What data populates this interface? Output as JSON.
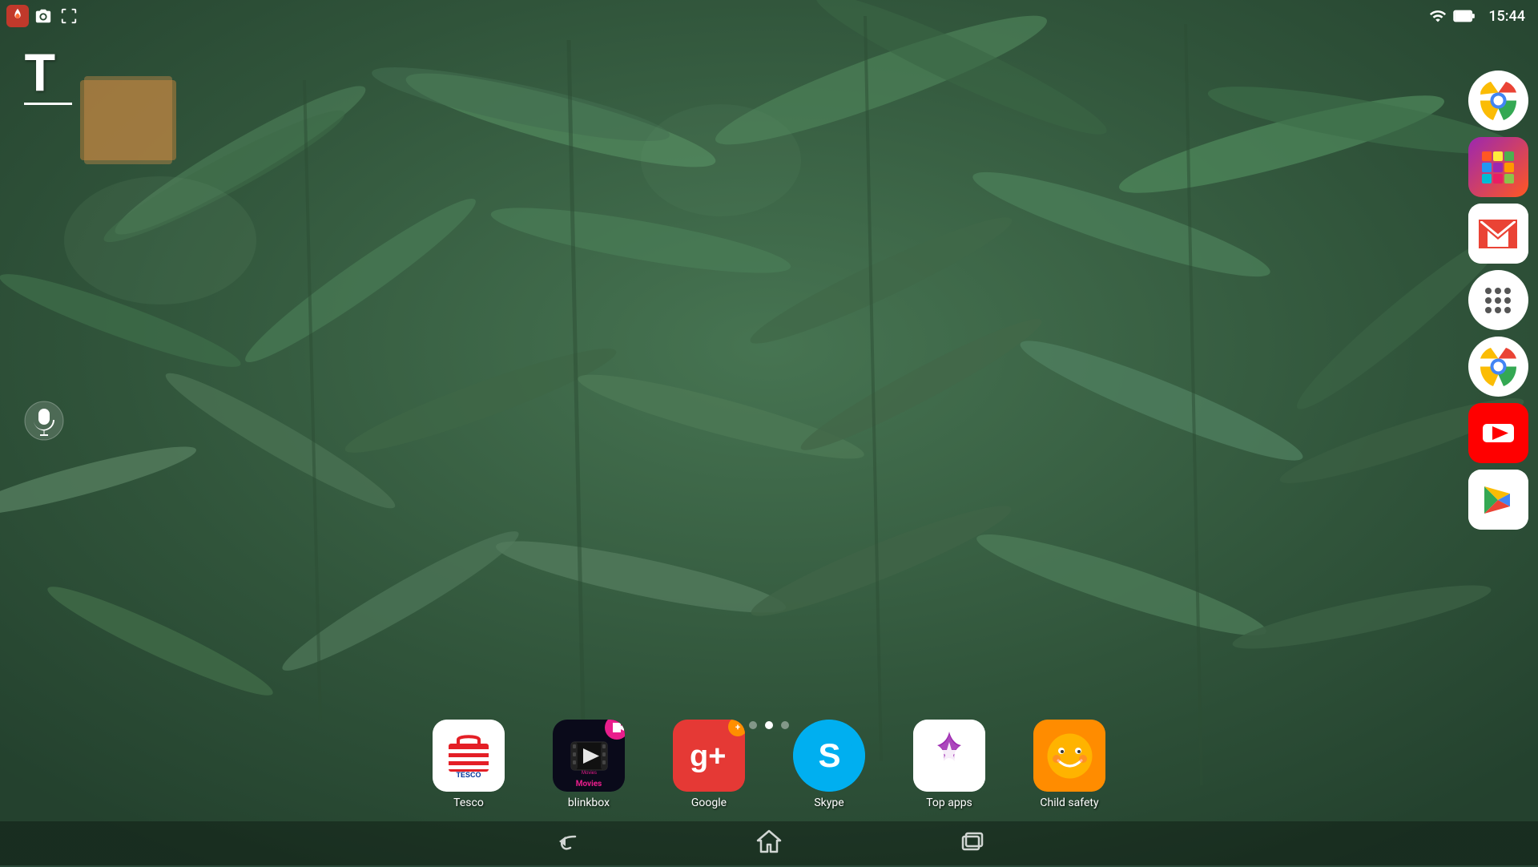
{
  "statusBar": {
    "time": "15:44",
    "battery": "100",
    "wifi": true
  },
  "notificationIcons": [
    {
      "name": "sinister-icon",
      "symbol": "🔥"
    },
    {
      "name": "camera-icon",
      "symbol": "📷"
    },
    {
      "name": "screenshot-icon",
      "symbol": "📸"
    }
  ],
  "leftWidget": {
    "letter": "T"
  },
  "voiceSearch": {
    "label": "Voice Search"
  },
  "pageIndicators": [
    {
      "active": false
    },
    {
      "active": true
    },
    {
      "active": false
    }
  ],
  "bottomApps": [
    {
      "label": "Tesco",
      "id": "tesco"
    },
    {
      "label": "blinkbox",
      "id": "blinkbox"
    },
    {
      "label": "Google",
      "id": "google-plus"
    },
    {
      "label": "Skype",
      "id": "skype"
    },
    {
      "label": "Top apps",
      "id": "top-apps"
    },
    {
      "label": "Child safety",
      "id": "child-safety"
    }
  ],
  "rightDock": [
    {
      "label": "Chrome",
      "id": "chrome-dock"
    },
    {
      "label": "Hue",
      "id": "hue-dock"
    },
    {
      "label": "Gmail",
      "id": "gmail-dock"
    },
    {
      "label": "App Drawer",
      "id": "app-drawer-dock"
    },
    {
      "label": "Chrome2",
      "id": "chrome2-dock"
    },
    {
      "label": "YouTube",
      "id": "youtube-dock"
    },
    {
      "label": "Play Store",
      "id": "play-dock"
    }
  ],
  "navBar": {
    "back": "←",
    "home": "⌂",
    "recents": "▭"
  }
}
